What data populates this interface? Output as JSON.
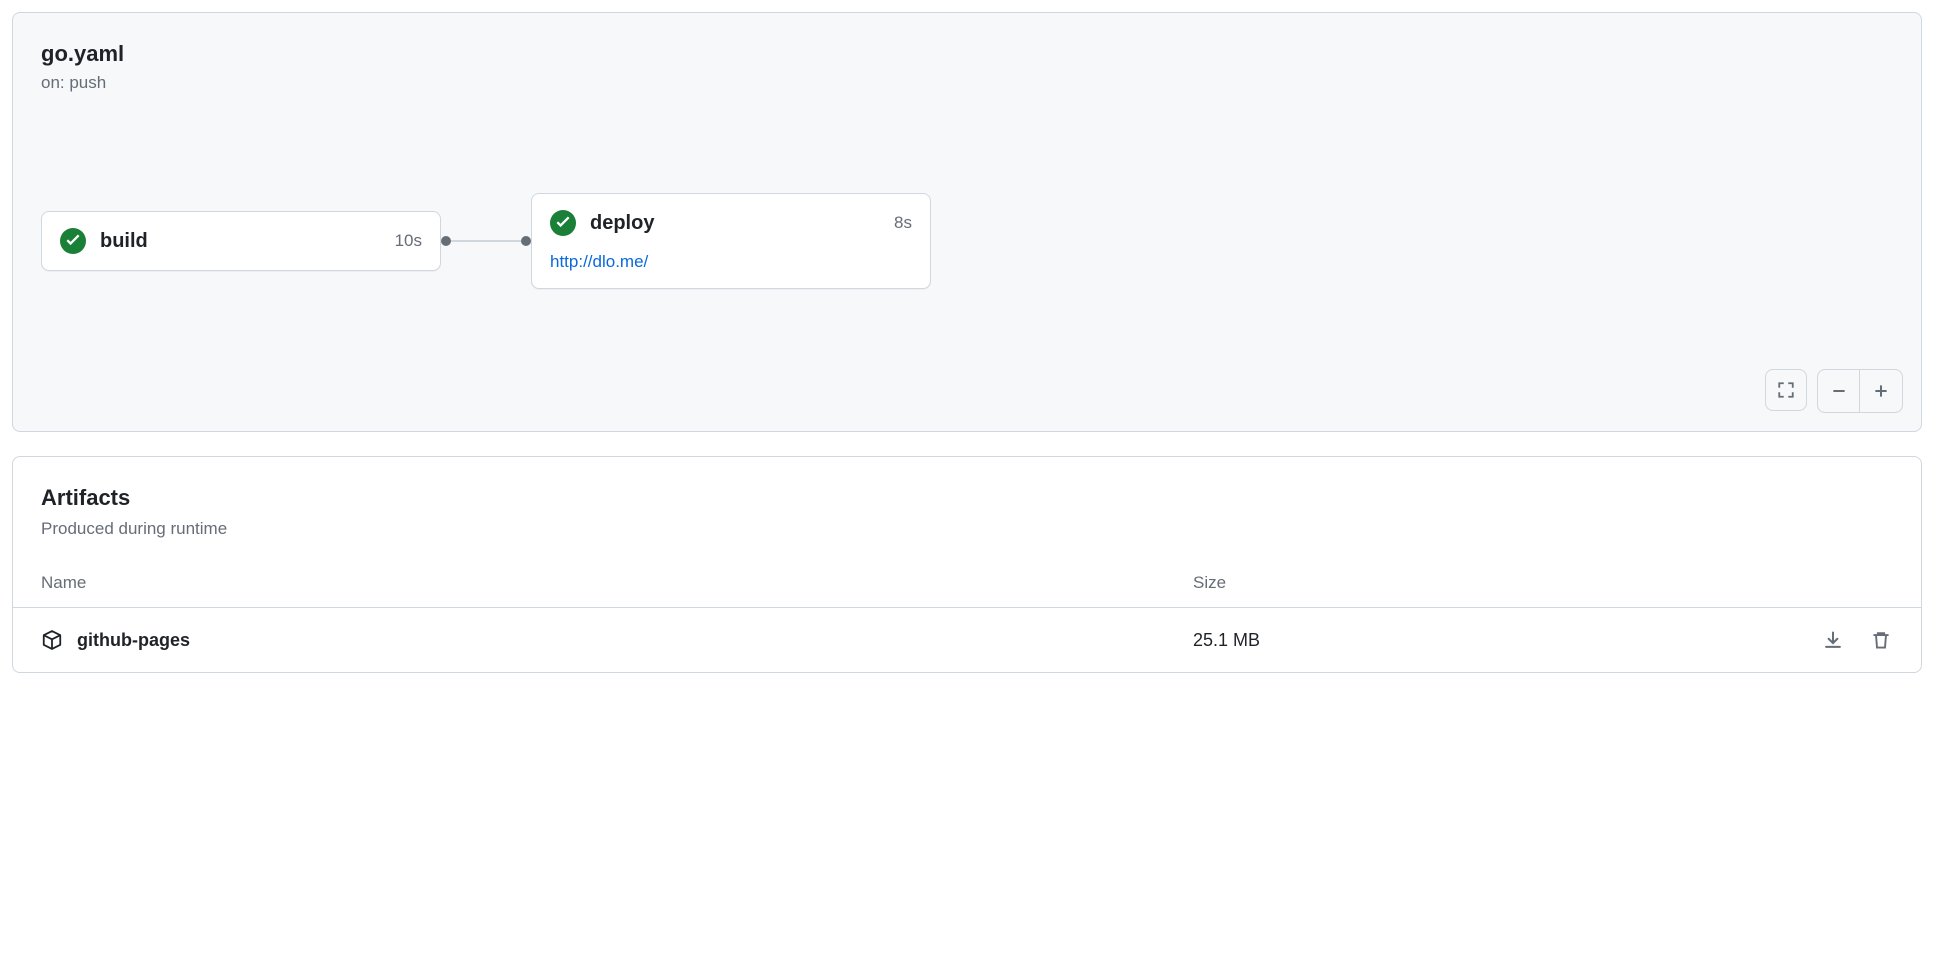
{
  "workflow": {
    "title": "go.yaml",
    "trigger": "on: push",
    "jobs": [
      {
        "name": "build",
        "duration": "10s",
        "status": "success"
      },
      {
        "name": "deploy",
        "duration": "8s",
        "status": "success",
        "url": "http://dlo.me/"
      }
    ]
  },
  "artifacts": {
    "title": "Artifacts",
    "subtitle": "Produced during runtime",
    "columns": {
      "name": "Name",
      "size": "Size"
    },
    "items": [
      {
        "name": "github-pages",
        "size": "25.1 MB"
      }
    ]
  }
}
